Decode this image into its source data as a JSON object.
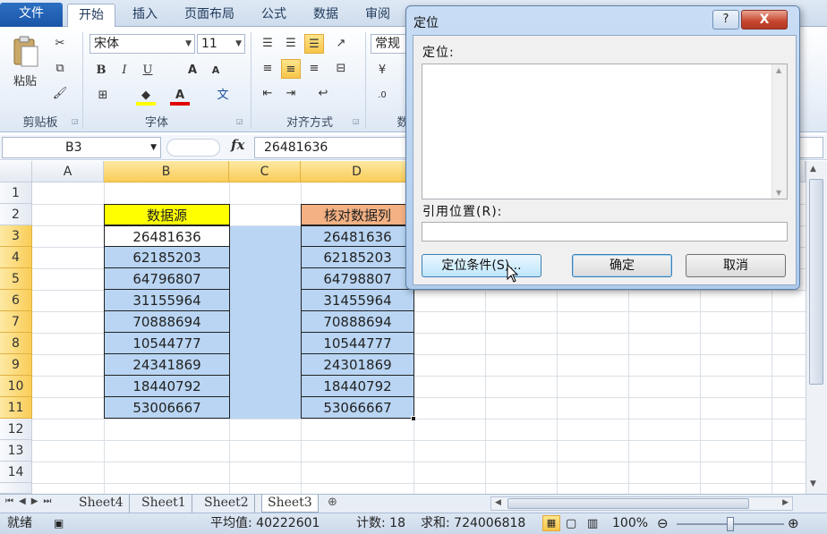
{
  "ribbon": {
    "tabs": [
      "文件",
      "开始",
      "插入",
      "页面布局",
      "公式",
      "数据",
      "审阅"
    ],
    "active_tab": "开始",
    "paste_label": "粘贴",
    "font_name": "宋体",
    "font_size": "11",
    "number_format": "常规",
    "groups": [
      "剪贴板",
      "字体",
      "对齐方式",
      "数"
    ],
    "bold": "B",
    "italic": "I",
    "underline": "U",
    "grow_font": "A",
    "shrink_font": "A",
    "wen": "文"
  },
  "formula_bar": {
    "name_box": "B3",
    "fx": "fx",
    "formula": "26481636"
  },
  "grid": {
    "columns": [
      "A",
      "B",
      "C",
      "D"
    ],
    "rows": [
      "1",
      "2",
      "3",
      "4",
      "5",
      "6",
      "7",
      "8",
      "9",
      "10",
      "11",
      "12",
      "13",
      "14"
    ],
    "header_b": "数据源",
    "header_d": "核对数据列",
    "column_b": [
      "26481636",
      "62185203",
      "64796807",
      "31155964",
      "70888694",
      "10544777",
      "24341869",
      "18440792",
      "53006667"
    ],
    "column_d": [
      "26481636",
      "62185203",
      "64798807",
      "31455964",
      "70888694",
      "10544777",
      "24301869",
      "18440792",
      "53066667"
    ],
    "colors": {
      "header_b": "#ffff00",
      "header_d": "#f4b183",
      "selection": "#b9d5f3"
    }
  },
  "sheets": [
    "Sheet4",
    "Sheet1",
    "Sheet2",
    "Sheet3"
  ],
  "active_sheet": "Sheet3",
  "status": {
    "mode": "就绪",
    "average": "平均值: 40222601",
    "count": "计数: 18",
    "sum": "求和: 724006818",
    "zoom": "100%"
  },
  "dialog": {
    "title": "定位",
    "help": "?",
    "close": "X",
    "goto_label": "定位:",
    "reference_label": "引用位置(R):",
    "special_button": "定位条件(S)...",
    "ok_button": "确定",
    "cancel_button": "取消"
  }
}
